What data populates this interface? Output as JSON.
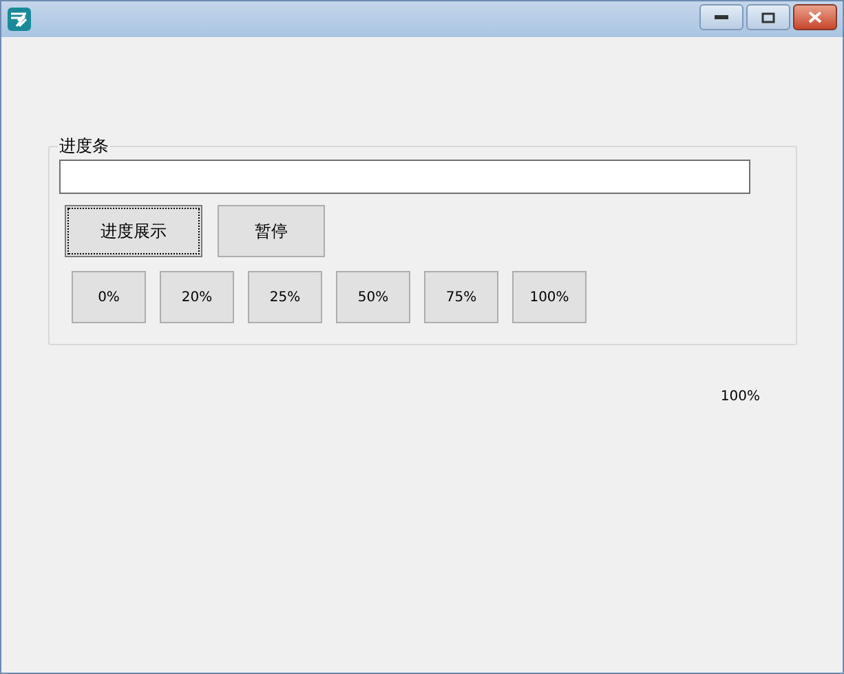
{
  "group": {
    "title": "进度条",
    "progress": {
      "level": 0
    },
    "actions": [
      {
        "label": "进度展示",
        "focused": true
      },
      {
        "label": "暂停",
        "focused": false
      }
    ],
    "presets": [
      "0%",
      "20%",
      "25%",
      "50%",
      "75%",
      "100%"
    ]
  },
  "status_label": "100%"
}
